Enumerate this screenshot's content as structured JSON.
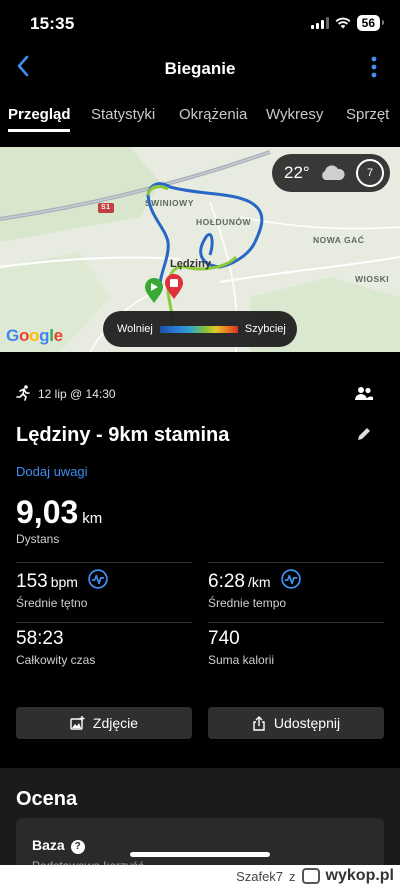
{
  "status": {
    "time": "15:35",
    "battery": "56"
  },
  "nav": {
    "title": "Bieganie"
  },
  "tabs": [
    "Przegląd",
    "Statystyki",
    "Okrążenia",
    "Wykresy",
    "Sprzęt"
  ],
  "map": {
    "weather_temp": "22°",
    "wind": "7",
    "labels": {
      "swiniowy": "ŚWINIOWY",
      "holdunow": "HOŁDUNÓW",
      "nowa_gac": "NOWA GAĆ",
      "wioski": "WIOSKI",
      "ledziny": "Lędziny",
      "road": "S1"
    },
    "legend": {
      "slow": "Wolniej",
      "fast": "Szybciej"
    },
    "attribution": "Google"
  },
  "activity": {
    "date": "12 lip @ 14:30",
    "title": "Lędziny - 9km stamina",
    "add_note": "Dodaj uwagi",
    "distance": {
      "value": "9,03",
      "unit": "km",
      "label": "Dystans"
    },
    "heart_rate": {
      "value": "153",
      "unit": "bpm",
      "label": "Średnie tętno"
    },
    "pace": {
      "value": "6:28",
      "unit": "/km",
      "label": "Średnie tempo"
    },
    "time": {
      "value": "58:23",
      "label": "Całkowity czas"
    },
    "calories": {
      "value": "740",
      "label": "Suma kalorii"
    }
  },
  "buttons": {
    "photo": "Zdjęcie",
    "share": "Udostępnij"
  },
  "rating": {
    "heading": "Ocena",
    "card_title": "Baza",
    "card_subtitle": "Podstawowa korzyść"
  },
  "watermark": {
    "user": "Szafek7",
    "sep": "z",
    "brand": "wykop.pl"
  },
  "colors": {
    "accent": "#3f8ef0",
    "route_blue": "#2767c6",
    "route_green": "#8fc93a",
    "start": "#39a935",
    "stop": "#e0303a"
  }
}
